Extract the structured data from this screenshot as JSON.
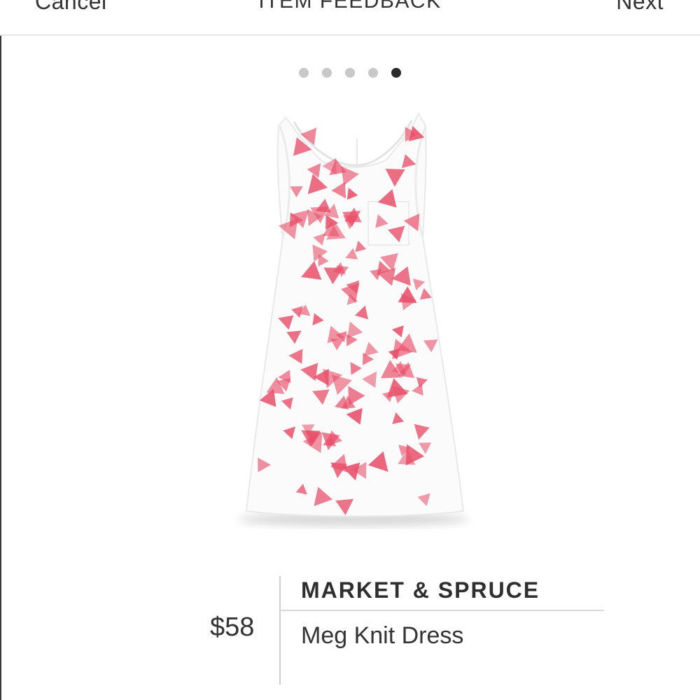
{
  "nav": {
    "cancel_label": "Cancel",
    "title": "ITEM FEEDBACK",
    "next_label": "Next"
  },
  "pager": {
    "total": 5,
    "active_index": 5
  },
  "product": {
    "image_icon": "dress-image",
    "print_color": "#e8506a",
    "brand": "MARKET & SPRUCE",
    "name": "Meg Knit Dress",
    "price": "$58"
  }
}
